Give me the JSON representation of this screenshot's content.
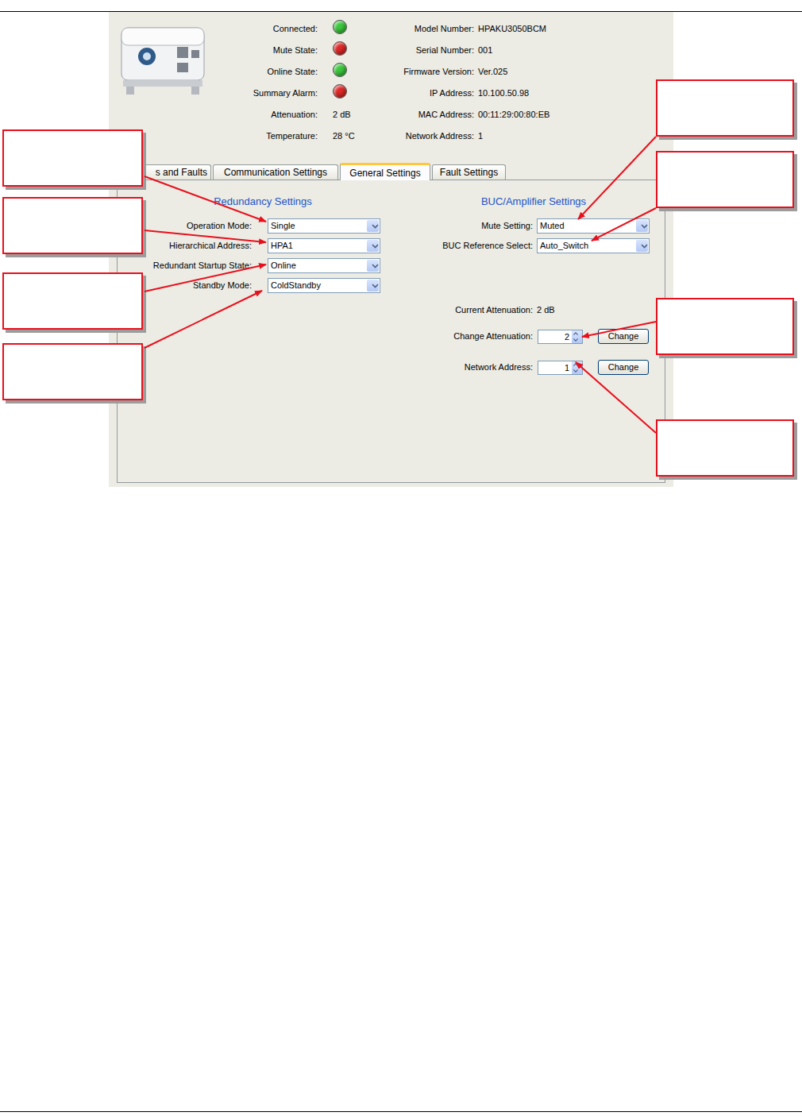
{
  "device": {
    "status": [
      {
        "label": "Connected:",
        "kind": "led",
        "color": "#3cc83c"
      },
      {
        "label": "Mute State:",
        "kind": "led",
        "color": "#e02828"
      },
      {
        "label": "Online State:",
        "kind": "led",
        "color": "#3cc83c"
      },
      {
        "label": "Summary Alarm:",
        "kind": "led",
        "color": "#e02828"
      },
      {
        "label": "Attenuation:",
        "kind": "text",
        "value": "2 dB"
      },
      {
        "label": "Temperature:",
        "kind": "text",
        "value": "28 °C"
      }
    ],
    "info": [
      {
        "label": "Model Number:",
        "value": "HPAKU3050BCM"
      },
      {
        "label": "Serial Number:",
        "value": "001"
      },
      {
        "label": "Firmware Version:",
        "value": "Ver.025"
      },
      {
        "label": "IP Address:",
        "value": "10.100.50.98"
      },
      {
        "label": "MAC Address:",
        "value": "00:11:29:00:80:EB"
      },
      {
        "label": "Network Address:",
        "value": "1"
      }
    ]
  },
  "tabs": [
    {
      "label": "s and Faults",
      "selected": false
    },
    {
      "label": "Communication Settings",
      "selected": false
    },
    {
      "label": "General Settings",
      "selected": true
    },
    {
      "label": "Fault Settings",
      "selected": false
    }
  ],
  "redundancy": {
    "title": "Redundancy Settings",
    "fields": [
      {
        "label": "Operation Mode:",
        "value": "Single"
      },
      {
        "label": "Hierarchical Address:",
        "value": "HPA1"
      },
      {
        "label": "Redundant Startup State:",
        "value": "Online"
      },
      {
        "label": "Standby Mode:",
        "value": "ColdStandby"
      }
    ]
  },
  "amplifier": {
    "title": "BUC/Amplifier Settings",
    "fields": [
      {
        "label": "Mute Setting:",
        "value": "Muted"
      },
      {
        "label": "BUC Reference Select:",
        "value": "Auto_Switch"
      }
    ],
    "current": {
      "label": "Current Attenuation:",
      "value": "2 dB"
    },
    "spinners": [
      {
        "label": "Change Attenuation:",
        "value": "2",
        "button": "Change"
      },
      {
        "label": "Network Address:",
        "value": "1",
        "button": "Change"
      }
    ]
  }
}
